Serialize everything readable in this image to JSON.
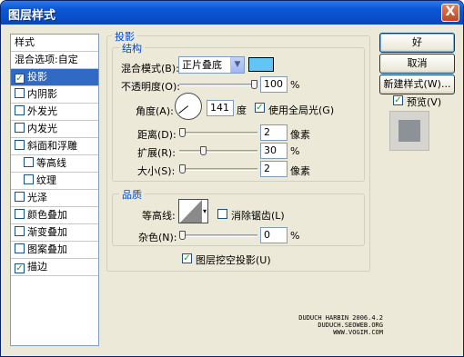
{
  "window": {
    "title": "图层样式",
    "close_label": "X"
  },
  "sidebar": {
    "header": "样式",
    "items": [
      {
        "label": "混合选项:自定",
        "checkbox": false,
        "checked": false,
        "selected": false
      },
      {
        "label": "投影",
        "checkbox": true,
        "checked": true,
        "selected": true
      },
      {
        "label": "内阴影",
        "checkbox": true,
        "checked": false,
        "selected": false
      },
      {
        "label": "外发光",
        "checkbox": true,
        "checked": false,
        "selected": false
      },
      {
        "label": "内发光",
        "checkbox": true,
        "checked": false,
        "selected": false
      },
      {
        "label": "斜面和浮雕",
        "checkbox": true,
        "checked": false,
        "selected": false
      },
      {
        "label": "等高线",
        "checkbox": true,
        "checked": false,
        "selected": false
      },
      {
        "label": "纹理",
        "checkbox": true,
        "checked": false,
        "selected": false
      },
      {
        "label": "光泽",
        "checkbox": true,
        "checked": false,
        "selected": false
      },
      {
        "label": "颜色叠加",
        "checkbox": true,
        "checked": false,
        "selected": false
      },
      {
        "label": "渐变叠加",
        "checkbox": true,
        "checked": false,
        "selected": false
      },
      {
        "label": "图案叠加",
        "checkbox": true,
        "checked": false,
        "selected": false
      },
      {
        "label": "描边",
        "checkbox": true,
        "checked": true,
        "selected": false
      }
    ]
  },
  "drop_shadow": {
    "section_title": "投影",
    "structure": {
      "title": "结构",
      "blend_mode_label": "混合模式(B):",
      "blend_mode_value": "正片叠底",
      "shadow_color": "#61c6f3",
      "opacity_label": "不透明度(O):",
      "opacity_value": "100",
      "opacity_fraction": 1.0,
      "percent_unit": "%",
      "angle_label": "角度(A):",
      "angle_value": "141",
      "angle_unit": "度",
      "global_light_label": "使用全局光(G)",
      "global_light_checked": true,
      "distance_label": "距离(D):",
      "distance_value": "2",
      "spread_label": "扩展(R):",
      "spread_value": "30",
      "size_label": "大小(S):",
      "size_value": "2",
      "pixel_unit": "像素"
    },
    "quality": {
      "title": "品质",
      "contour_label": "等高线:",
      "anti_alias_label": "消除锯齿(L)",
      "anti_alias_checked": false,
      "noise_label": "杂色(N):",
      "noise_value": "0"
    },
    "knockout_label": "图层挖空投影(U)",
    "knockout_checked": true
  },
  "buttons": {
    "ok": "好",
    "cancel": "取消",
    "new_style": "新建样式(W)..."
  },
  "preview": {
    "label": "预览(V)",
    "checked": true
  },
  "watermark": {
    "line1": "DUDUCH HARBIN 2006.4.2",
    "line2": "DUDUCH.SEOWEB.ORG",
    "line3": "WWW.VOGIM.COM"
  }
}
